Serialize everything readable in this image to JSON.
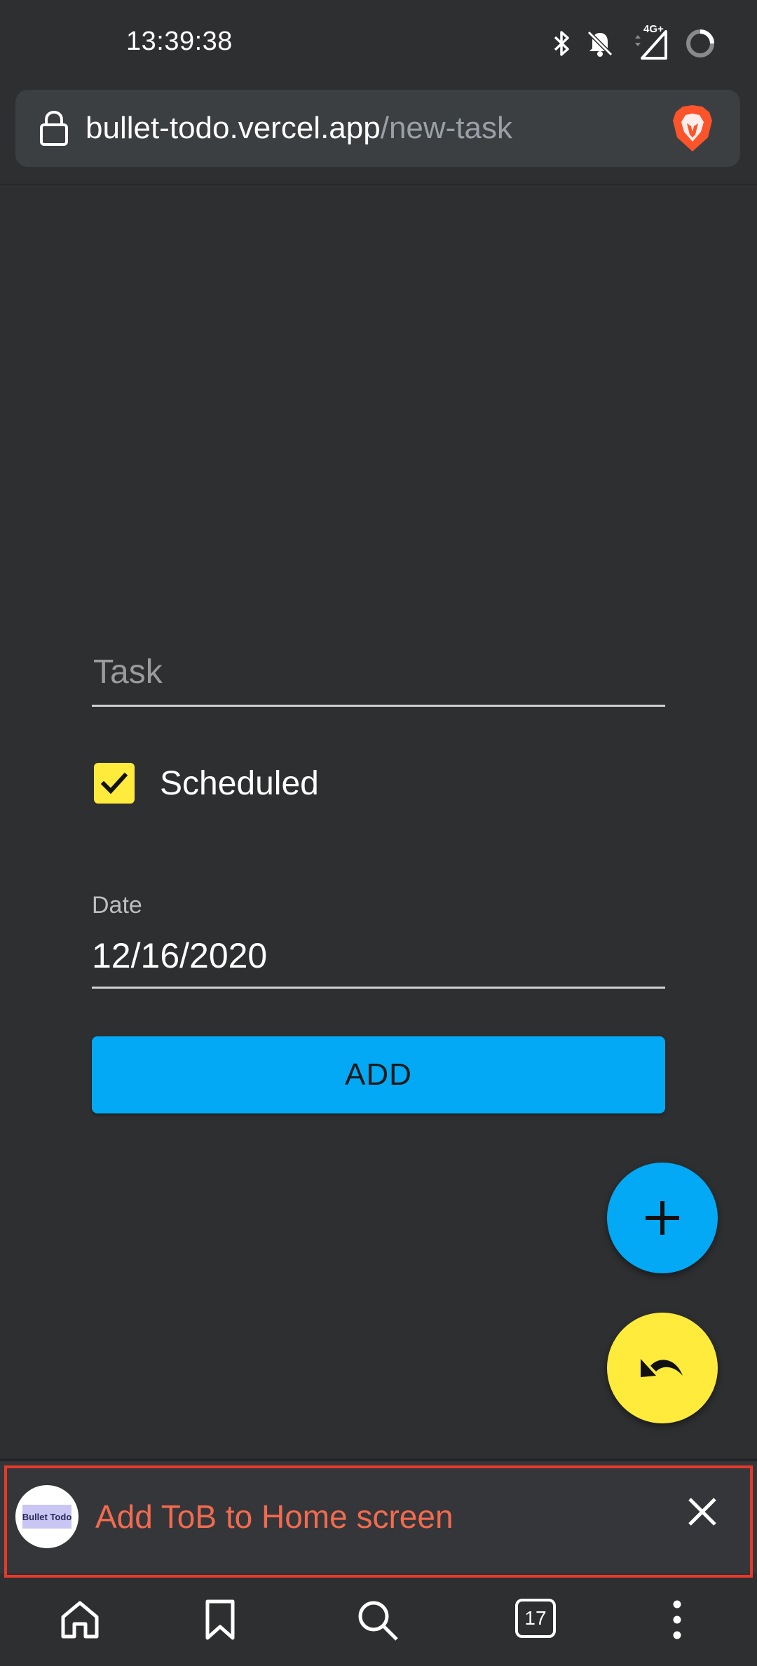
{
  "status_bar": {
    "time": "13:39:38",
    "network_label": "4G+",
    "icons": [
      "bluetooth-icon",
      "notifications-off-icon",
      "signal-icon",
      "battery-ring-icon"
    ]
  },
  "browser": {
    "url_domain": "bullet-todo.vercel.app",
    "url_path": "/new-task",
    "tabs_count": "17"
  },
  "form": {
    "task_placeholder": "Task",
    "task_value": "",
    "scheduled_label": "Scheduled",
    "scheduled_checked": true,
    "date_label": "Date",
    "date_value": "12/16/2020",
    "add_button_label": "ADD"
  },
  "fabs": {
    "add_icon": "plus-icon",
    "undo_icon": "undo-icon"
  },
  "banner": {
    "text": "Add ToB to Home screen",
    "app_logo_text": "Bullet Todo"
  },
  "colors": {
    "background": "#2e2f31",
    "accent_blue": "#03a9f4",
    "accent_yellow": "#ffeb3b",
    "banner_text": "#f26b4f",
    "highlight_border": "#e53a2a"
  }
}
